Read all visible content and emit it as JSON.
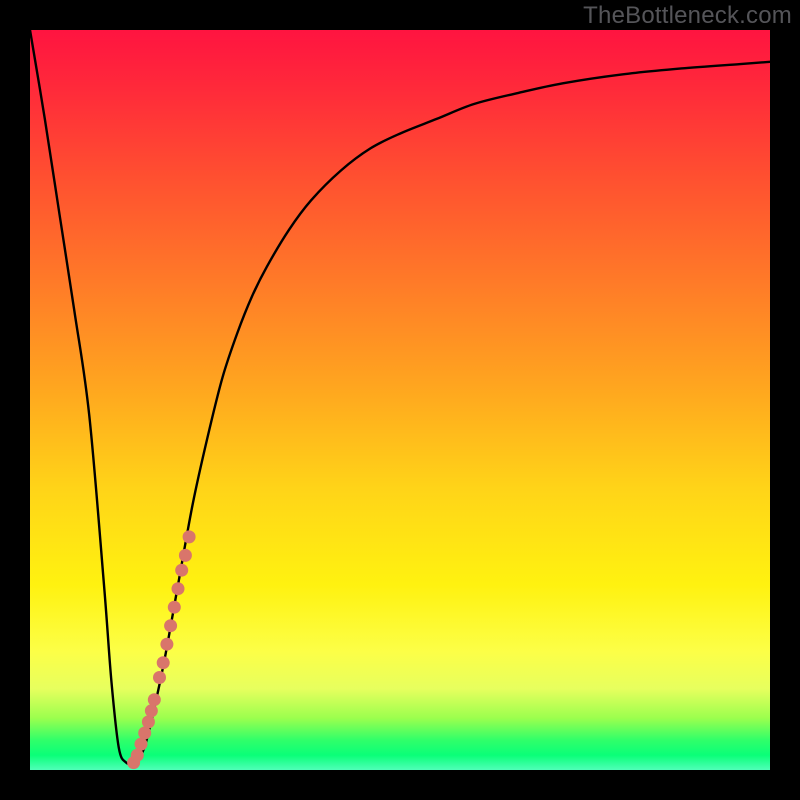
{
  "watermark": "TheBottleneck.com",
  "chart_data": {
    "type": "line",
    "title": "",
    "xlabel": "",
    "ylabel": "",
    "xlim": [
      0,
      100
    ],
    "ylim": [
      0,
      100
    ],
    "grid": false,
    "legend": false,
    "series": [
      {
        "name": "curve",
        "color": "#000000",
        "x": [
          0,
          2,
          4,
          6,
          8,
          10,
          11,
          12,
          13,
          14,
          15,
          16,
          18,
          20,
          22,
          24,
          26,
          28,
          30,
          32,
          35,
          38,
          42,
          46,
          50,
          55,
          60,
          66,
          72,
          80,
          88,
          96,
          100
        ],
        "y": [
          100,
          88,
          75,
          62,
          48,
          25,
          12,
          3,
          1,
          1,
          2,
          5,
          14,
          25,
          36,
          45,
          53,
          59,
          64,
          68,
          73,
          77,
          81,
          84,
          86,
          88,
          90,
          91.5,
          92.8,
          94,
          94.8,
          95.4,
          95.7
        ]
      }
    ],
    "markers": {
      "name": "highlight-dots",
      "color": "#d9756b",
      "points": [
        {
          "x": 14.0,
          "y": 1.0
        },
        {
          "x": 14.5,
          "y": 2.0
        },
        {
          "x": 15.0,
          "y": 3.5
        },
        {
          "x": 15.5,
          "y": 5.0
        },
        {
          "x": 16.0,
          "y": 6.5
        },
        {
          "x": 16.4,
          "y": 8.0
        },
        {
          "x": 16.8,
          "y": 9.5
        },
        {
          "x": 17.5,
          "y": 12.5
        },
        {
          "x": 18.0,
          "y": 14.5
        },
        {
          "x": 18.5,
          "y": 17.0
        },
        {
          "x": 19.0,
          "y": 19.5
        },
        {
          "x": 19.5,
          "y": 22.0
        },
        {
          "x": 20.0,
          "y": 24.5
        },
        {
          "x": 20.5,
          "y": 27.0
        },
        {
          "x": 21.0,
          "y": 29.0
        },
        {
          "x": 21.5,
          "y": 31.5
        }
      ]
    }
  }
}
